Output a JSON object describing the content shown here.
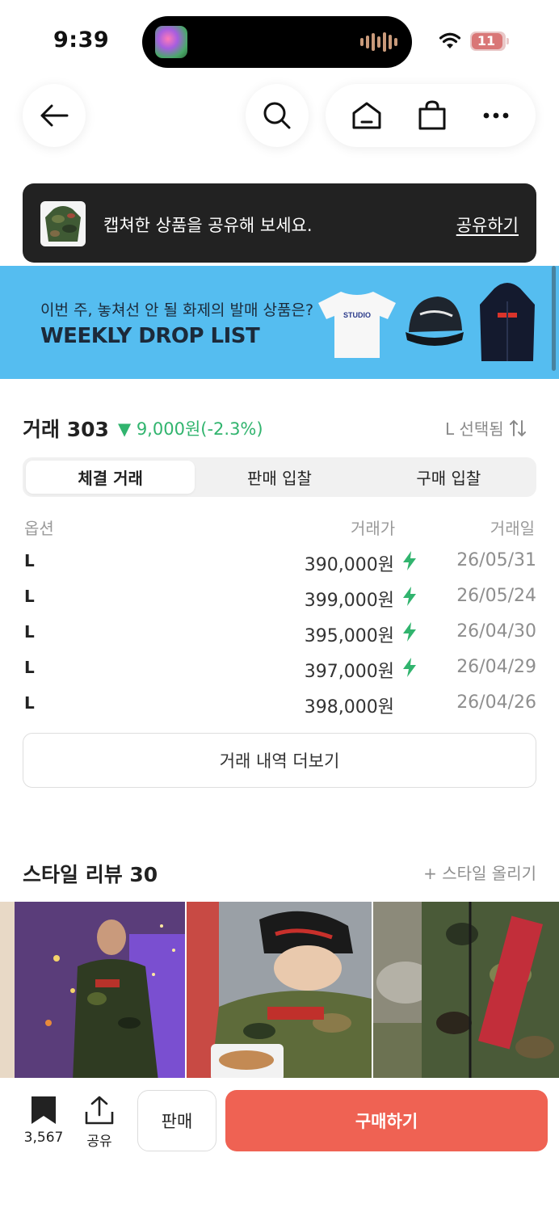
{
  "status_bar": {
    "time": "9:39",
    "battery": "11"
  },
  "toast": {
    "message": "캡쳐한 상품을 공유해 보세요.",
    "action": "공유하기"
  },
  "banner": {
    "subtitle": "이번 주, 놓쳐선 안 될 화제의 발매 상품은?",
    "title": "WEEKLY DROP LIST",
    "tshirt_text": "STUDIO"
  },
  "trades": {
    "heading": "거래 303",
    "change": "▼ 9,000원(-2.3%)",
    "size_selector": "L 선택됨",
    "tabs": [
      "체결 거래",
      "판매 입찰",
      "구매 입찰"
    ],
    "columns": {
      "option": "옵션",
      "price": "거래가",
      "date": "거래일"
    },
    "rows": [
      {
        "option": "L",
        "price": "390,000원",
        "fast": true,
        "date": "26/05/31"
      },
      {
        "option": "L",
        "price": "399,000원",
        "fast": true,
        "date": "26/05/24"
      },
      {
        "option": "L",
        "price": "395,000원",
        "fast": true,
        "date": "26/04/30"
      },
      {
        "option": "L",
        "price": "397,000원",
        "fast": true,
        "date": "26/04/29"
      },
      {
        "option": "L",
        "price": "398,000원",
        "fast": false,
        "date": "26/04/26"
      }
    ],
    "more_button": "거래 내역 더보기"
  },
  "style_reviews": {
    "heading": "스타일 리뷰 30",
    "upload": "+ 스타일 올리기"
  },
  "bottom_bar": {
    "bookmark_count": "3,567",
    "share_label": "공유",
    "sell_label": "판매",
    "buy_label": "구매하기"
  },
  "colors": {
    "accent_buy": "#ef6253",
    "price_down": "#31b46e",
    "banner_bg": "#55bdf0",
    "toast_bg": "#222222"
  }
}
